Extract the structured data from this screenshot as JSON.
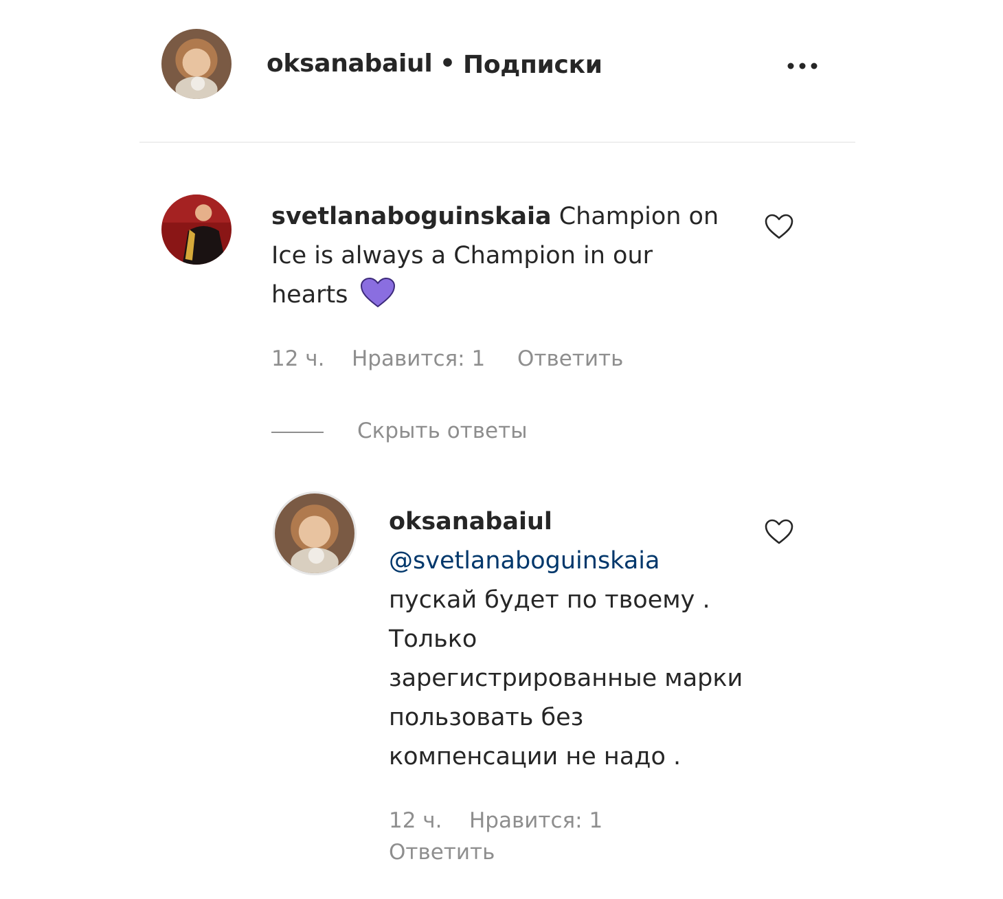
{
  "header": {
    "username": "oksanabaiul",
    "separator": "•",
    "follow_label": "Подписки",
    "more_icon": "more-horizontal-icon"
  },
  "comment": {
    "username": "svetlanaboguinskaia",
    "text": "Champion on Ice is always a Champion in our hearts",
    "emoji": "purple-heart-emoji",
    "time": "12 ч.",
    "likes": "Нравится: 1",
    "reply_label": "Ответить",
    "like_icon": "heart-outline-icon"
  },
  "hide_replies_label": "Скрыть ответы",
  "reply": {
    "username": "oksanabaiul",
    "mention": "@svetlanaboguinskaia",
    "text": "пускай будет по твоему . Только зарегистрированные марки пользовать без компенсации не надо .",
    "time": "12 ч.",
    "likes": "Нравится: 1",
    "reply_label": "Ответить",
    "like_icon": "heart-outline-icon"
  },
  "colors": {
    "text": "#262626",
    "meta": "#8e8e8e",
    "mention": "#00376b",
    "divider": "#efefef",
    "emoji_heart": "#8a6ee0"
  }
}
